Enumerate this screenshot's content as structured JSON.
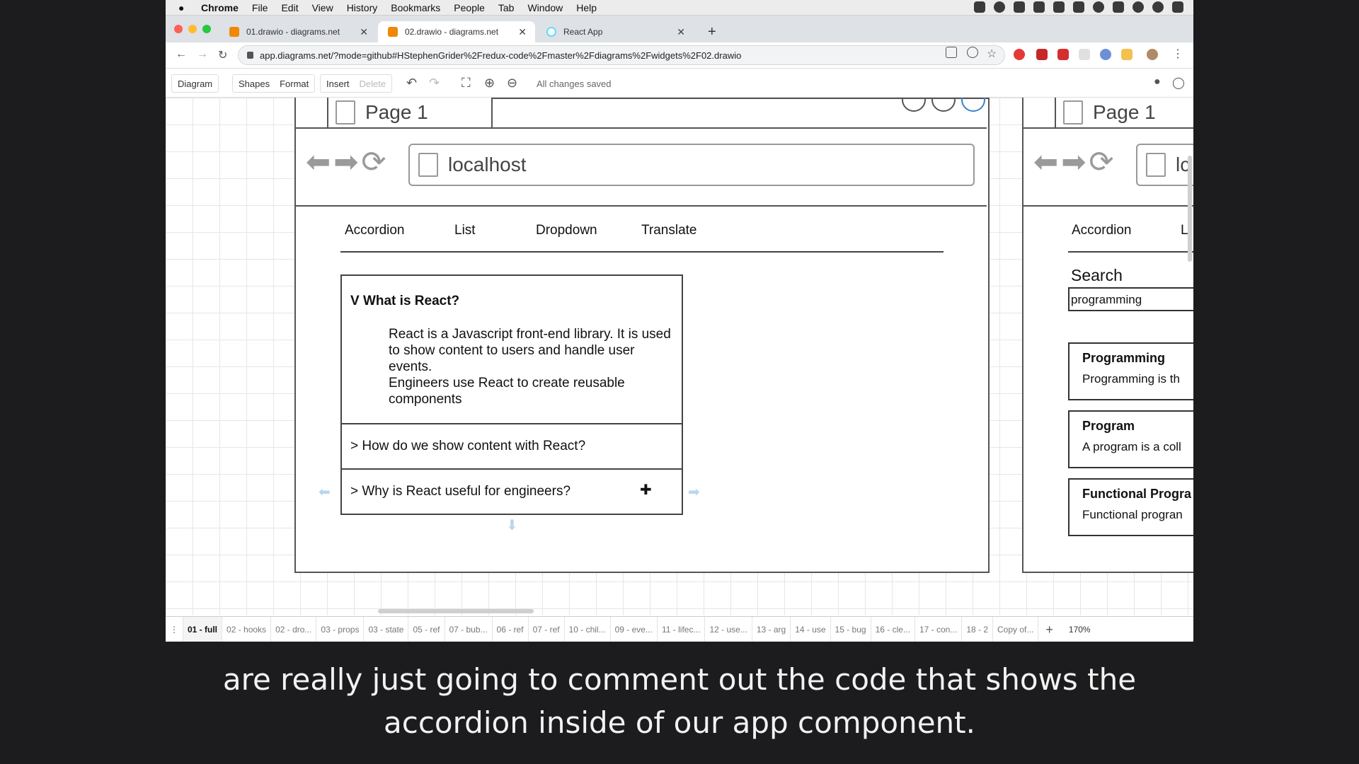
{
  "menubar": {
    "app": "Chrome",
    "items": [
      "File",
      "Edit",
      "View",
      "History",
      "Bookmarks",
      "People",
      "Tab",
      "Window",
      "Help"
    ]
  },
  "tabs": [
    {
      "title": "01.drawio - diagrams.net",
      "icon": "drawio-icon",
      "active": false
    },
    {
      "title": "02.drawio - diagrams.net",
      "icon": "drawio-icon",
      "active": true
    },
    {
      "title": "React App",
      "icon": "react-icon",
      "active": false
    }
  ],
  "address": {
    "url": "app.diagrams.net/?mode=github#HStephenGrider%2Fredux-code%2Fmaster%2Fdiagrams%2Fwidgets%2F02.drawio"
  },
  "toolbar": {
    "diagram": "Diagram",
    "shapes": "Shapes",
    "format": "Format",
    "insert": "Insert",
    "delete": "Delete",
    "status": "All changes saved"
  },
  "mockup_left": {
    "page_tab": "Page 1",
    "url": "localhost",
    "nav": [
      "Accordion",
      "List",
      "Dropdown",
      "Translate"
    ],
    "accordion": {
      "open_title": "V  What is React?",
      "open_body_1": "React is a Javascript front-end library. It is used",
      "open_body_2": "to show content to users and handle user",
      "open_body_3": "events.",
      "open_body_4": "Engineers use React to create reusable",
      "open_body_5": "components",
      "row2": ">  How do we show content with React?",
      "row3": ">  Why is React useful for engineers?"
    }
  },
  "mockup_right": {
    "page_tab": "Page 1",
    "url": "lc",
    "nav": [
      "Accordion",
      "L"
    ],
    "search_label": "Search",
    "search_value": "programming",
    "cards": [
      {
        "title": "Programming",
        "desc": "Programming is th"
      },
      {
        "title": "Program",
        "desc": "A program is a coll"
      },
      {
        "title": "Functional Progra",
        "desc": "Functional progran"
      }
    ]
  },
  "page_tabs": [
    "01 - full",
    "02 - hooks",
    "02 - dro...",
    "03 - props",
    "03 - state",
    "05 - ref",
    "07 - bub...",
    "06 - ref",
    "07 - ref",
    "10 - chil...",
    "09 - eve...",
    "11 - lifec...",
    "12 - use...",
    "13 - arg",
    "14 - use",
    "15 - bug",
    "16 - cle...",
    "17 - con...",
    "18 - 2",
    "Copy of..."
  ],
  "zoom": "170%",
  "caption": {
    "line1": "are really just going to comment out the code that shows the",
    "line2": "accordion inside of our app component."
  }
}
